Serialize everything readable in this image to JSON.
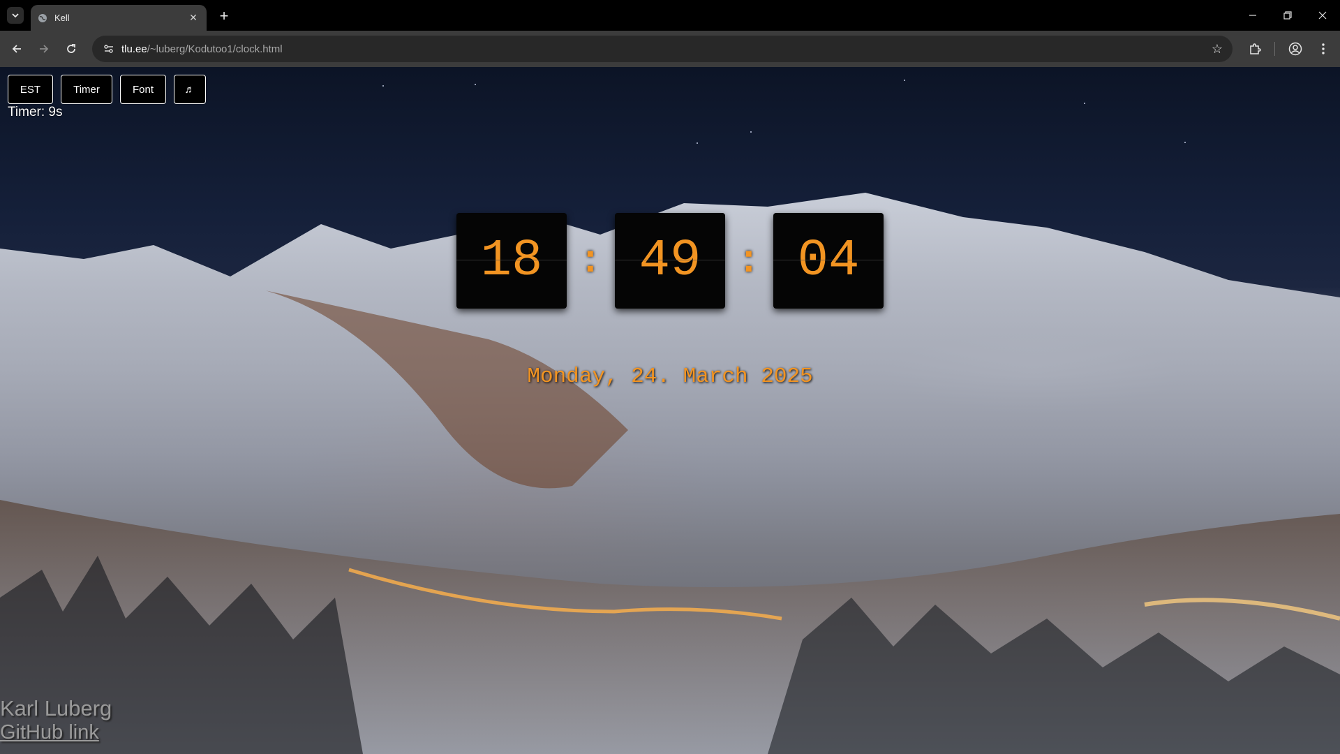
{
  "browser": {
    "tab": {
      "title": "Kell",
      "favicon": "globe-icon"
    },
    "address": {
      "host": "tlu.ee",
      "path": "/~luberg/Kodutoo1/clock.html"
    },
    "icons": {
      "tab_list": "chevron-down-icon",
      "new_tab": "plus-icon",
      "minimize": "minimize-icon",
      "restore": "restore-icon",
      "close": "close-icon",
      "back": "back-arrow-icon",
      "forward": "forward-arrow-icon",
      "reload": "reload-icon",
      "site_info": "site-info-icon",
      "bookmark": "star-icon",
      "extensions": "puzzle-icon",
      "profile": "profile-icon",
      "menu": "kebab-menu-icon"
    }
  },
  "page": {
    "buttons": {
      "timezone": "EST",
      "timer": "Timer",
      "font": "Font",
      "music": "♬"
    },
    "timer_status": "Timer: 9s",
    "clock": {
      "hours": "18",
      "minutes": "49",
      "seconds": "04",
      "separator": ":"
    },
    "date": "Monday, 24. March 2025",
    "author": "Karl Luberg",
    "github_link": "GitHub link",
    "colors": {
      "accent": "#f29422",
      "button_bg": "#000000",
      "button_border": "#ffffff"
    }
  }
}
